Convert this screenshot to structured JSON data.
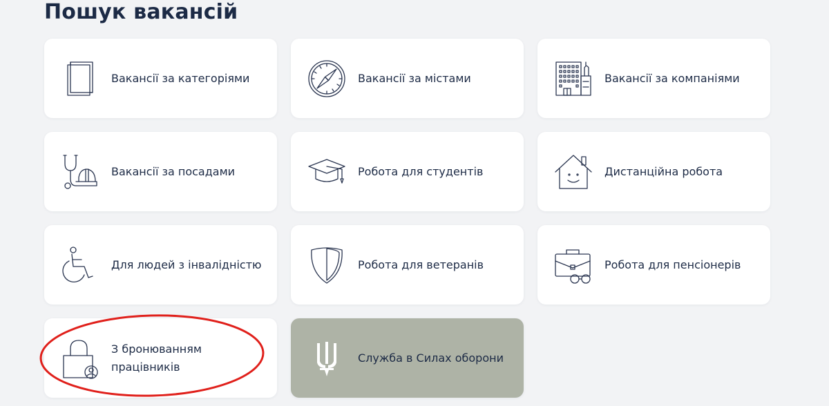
{
  "page": {
    "title": "Пошук вакансій"
  },
  "cards": [
    {
      "label": "Вакансії за категоріями",
      "icon": "documents-icon"
    },
    {
      "label": "Вакансії за містами",
      "icon": "compass-icon"
    },
    {
      "label": "Вакансії за компаніями",
      "icon": "office-building-icon"
    },
    {
      "label": "Вакансії за посадами",
      "icon": "stethoscope-helmet-icon"
    },
    {
      "label": "Робота для студентів",
      "icon": "graduation-cap-icon"
    },
    {
      "label": "Дистанційна робота",
      "icon": "smiling-house-icon"
    },
    {
      "label": "Для людей з інвалідністю",
      "icon": "wheelchair-icon"
    },
    {
      "label": "Робота для ветеранів",
      "icon": "shield-icon"
    },
    {
      "label": "Робота для пенсіонерів",
      "icon": "briefcase-glasses-icon"
    },
    {
      "label": "З бронюванням працівників",
      "icon": "lock-person-icon"
    },
    {
      "label": "Служба в Силах оборони",
      "icon": "trident-icon"
    }
  ],
  "colors": {
    "background": "#f2f3f5",
    "card": "#ffffff",
    "highlight_card": "#aeb3a6",
    "text": "#1c2a45",
    "annotation_ellipse": "#e0201b"
  }
}
